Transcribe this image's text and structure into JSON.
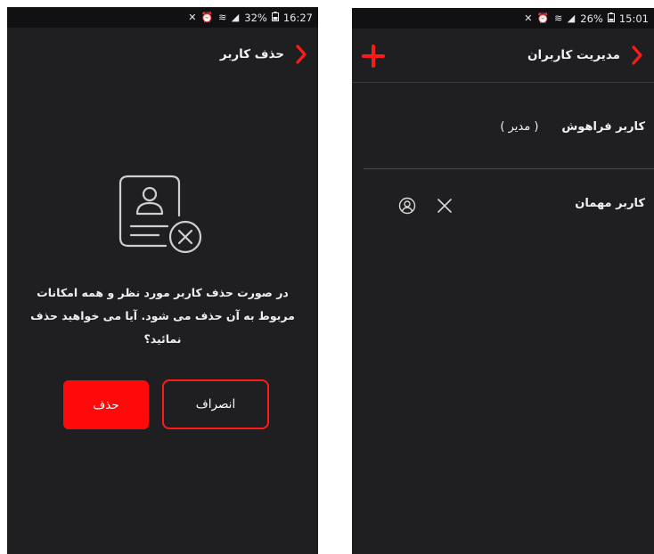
{
  "left_screen": {
    "status": {
      "icons": "✕ ⏰ ≋ ◢",
      "battery": "32%",
      "battery_icon": "battery-icon",
      "time": "16:27"
    },
    "appbar": {
      "title": "حذف کاربر",
      "back_icon": "chevron-right-icon"
    },
    "icon": "user-card-remove-icon",
    "message": "در صورت حذف کاربر  مورد نظر و همه امکانات مربوط به آن حذف می شود. آیا می خواهید حذف نمائید؟",
    "buttons": {
      "delete": "حذف",
      "cancel": "انصراف"
    },
    "colors": {
      "accent": "#ff0a0a",
      "background": "#1f1f21"
    }
  },
  "right_screen": {
    "status": {
      "icons": "✕ ⏰ ≋ ◢",
      "battery": "26%",
      "battery_icon": "battery-icon",
      "time": "15:01"
    },
    "appbar": {
      "title": "مدیریت کاربران",
      "back_icon": "chevron-right-icon",
      "add_icon": "plus-icon"
    },
    "users": [
      {
        "name": "کاربر فراهوش",
        "role": "( مدیر )"
      },
      {
        "name": "کاربر مهمان",
        "actions": [
          "close-icon",
          "user-icon"
        ]
      }
    ]
  }
}
